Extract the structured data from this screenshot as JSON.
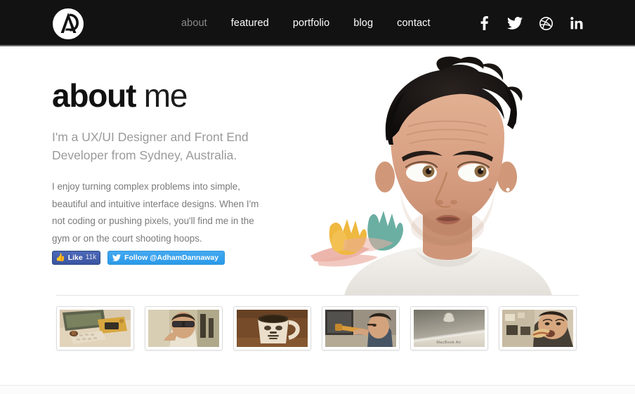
{
  "site": {
    "logo_alt": "AD monogram logo",
    "brand_dark": "#121212",
    "accent_blue": "#4c69ba",
    "accent_twitter": "#44a9f2"
  },
  "header": {
    "nav": [
      {
        "label": "about",
        "active": true
      },
      {
        "label": "featured",
        "active": false
      },
      {
        "label": "portfolio",
        "active": false
      },
      {
        "label": "blog",
        "active": false
      },
      {
        "label": "contact",
        "active": false
      }
    ],
    "social": [
      {
        "name": "facebook",
        "glyph": "facebook-icon"
      },
      {
        "name": "twitter",
        "glyph": "twitter-icon"
      },
      {
        "name": "dribbble",
        "glyph": "dribbble-icon"
      },
      {
        "name": "linkedin",
        "glyph": "linkedin-icon"
      }
    ]
  },
  "hero": {
    "title_bold": "about",
    "title_light": " me",
    "subtitle": "I'm a UX/UI Designer and Front End Developer from Sydney, Australia.",
    "body": "I enjoy turning complex problems into simple, beautiful and intuitive interface designs. When I'm not coding or pushing pixels, you'll find me in the gym or on the court shooting hoops.",
    "facebook_button": {
      "label": "Like",
      "count": "11k"
    },
    "twitter_button": {
      "label": "Follow @AdhamDannaway"
    },
    "portrait_alt": "Portrait photo of designer looking upward with colourful paint strokes"
  },
  "thumbnails": [
    {
      "caption": "Desk with monitor, keyboard and yellow camera"
    },
    {
      "caption": "Man wearing sunglasses pointing at camera"
    },
    {
      "caption": "Stormtrooper coffee mug on wooden table"
    },
    {
      "caption": "Man aiming a toy gun at a screen"
    },
    {
      "caption": "MacBook Air laptop lid close-up"
    },
    {
      "caption": "Man eating a burger in a kitchen"
    }
  ]
}
